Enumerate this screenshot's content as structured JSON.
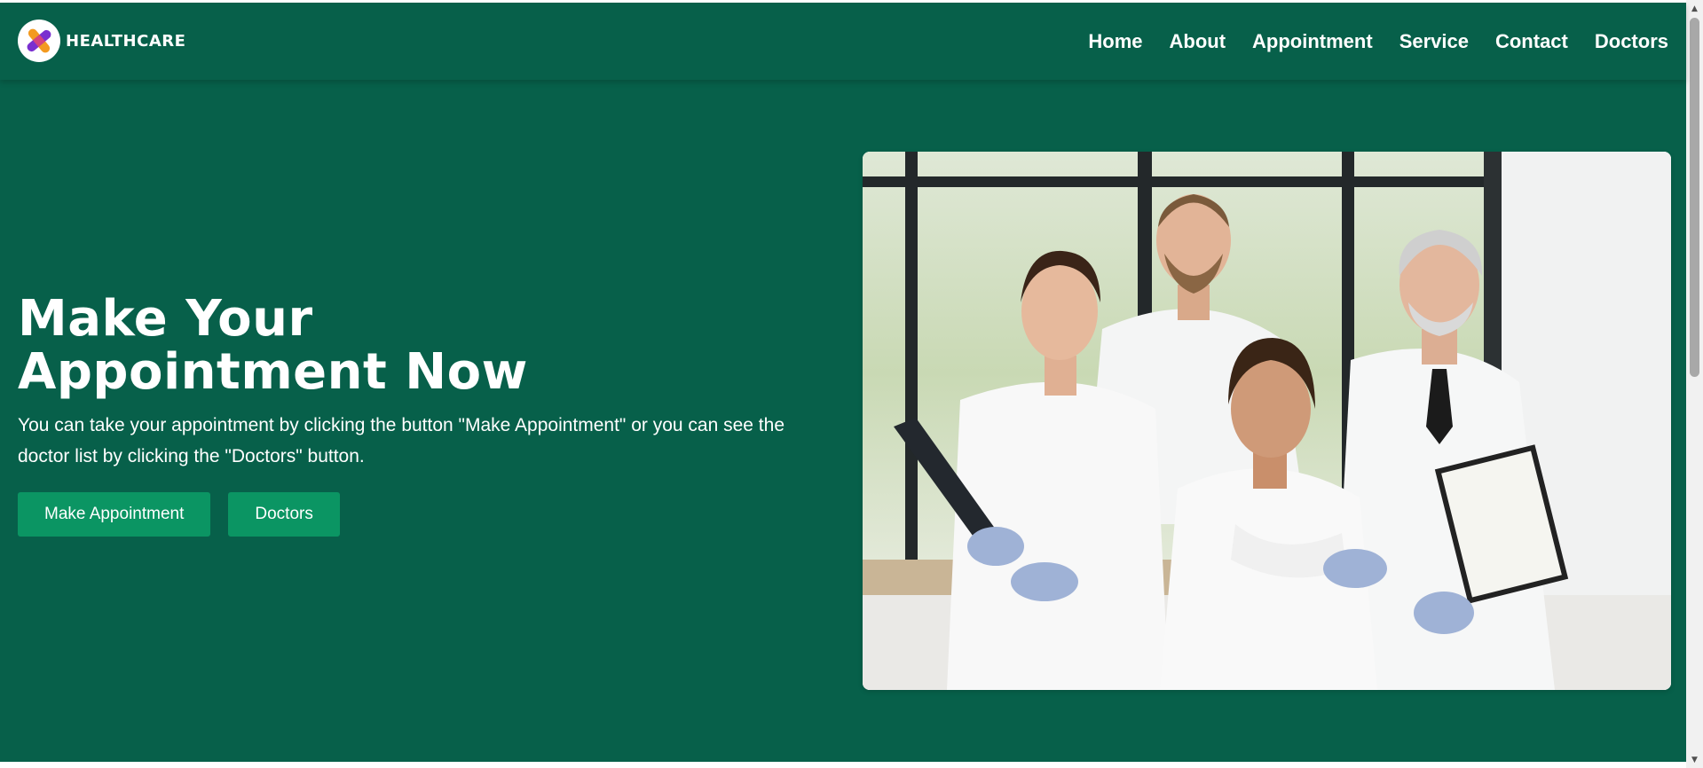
{
  "brand": {
    "name": "HEALTHCARE",
    "logo_icon": "medical-cross-logo-icon"
  },
  "nav": {
    "items": [
      {
        "label": "Home"
      },
      {
        "label": "About"
      },
      {
        "label": "Appointment"
      },
      {
        "label": "Service"
      },
      {
        "label": "Contact"
      },
      {
        "label": "Doctors"
      }
    ]
  },
  "hero": {
    "title": "Make Your Appointment Now",
    "description": "You can take your appointment by clicking the button \"Make Appointment\" or you can see the doctor list by clicking the \"Doctors\" button.",
    "primary_button": "Make Appointment",
    "secondary_button": "Doctors",
    "image": "doctors-team-photo"
  },
  "colors": {
    "primary": "#07604a",
    "button": "#0b9563",
    "text": "#ffffff"
  },
  "scrollbar": {
    "up_icon": "scroll-up-arrow-icon",
    "down_icon": "scroll-down-arrow-icon"
  }
}
